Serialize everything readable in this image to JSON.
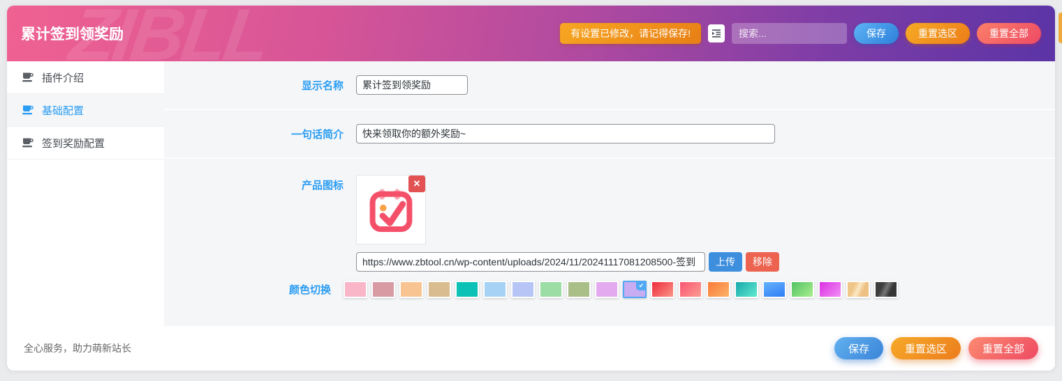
{
  "header": {
    "title": "累计签到领奖励",
    "watermark": "ZIBLL",
    "alert": "有设置已修改，请记得保存!",
    "search_placeholder": "搜索...",
    "save_label": "保存",
    "reset_selection_label": "重置选区",
    "reset_all_label": "重置全部"
  },
  "sidebar": {
    "items": [
      {
        "label": "插件介绍",
        "active": false
      },
      {
        "label": "基础配置",
        "active": true
      },
      {
        "label": "签到奖励配置",
        "active": false
      }
    ]
  },
  "form": {
    "display_name": {
      "label": "显示名称",
      "value": "累计签到领奖励"
    },
    "intro": {
      "label": "一句话简介",
      "value": "快来领取你的额外奖励~"
    },
    "product_icon": {
      "label": "产品图标",
      "delete_label": "✕",
      "url_value": "https://www.zbtool.cn/wp-content/uploads/2024/11/20241117081208500-签到",
      "upload_label": "上传",
      "remove_label": "移除"
    },
    "color_switch": {
      "label": "颜色切换",
      "selected_index": 10,
      "colors": [
        "#f8b6c8",
        "#d89ba4",
        "#f8c592",
        "#d9bd90",
        "#0cc1b5",
        "#a6d3f5",
        "#b7c5f6",
        "#9cdca5",
        "#aabe87",
        "#e3aaf0",
        "#c9adf2",
        "linear-gradient(135deg,#ee2c3c,#fa9486)",
        "linear-gradient(135deg,#fa5573,#fc9d92)",
        "linear-gradient(135deg,#f97b38,#fcb269)",
        "linear-gradient(135deg,#17a8ab,#62e9cf)",
        "linear-gradient(160deg,#66b2fc,#2e7ef5)",
        "linear-gradient(135deg,#52c265,#a9ee8d)",
        "linear-gradient(135deg,#da30e2,#f18ef5)",
        "linear-gradient(115deg,#efc689 30%,#fbe9c3 50%,#edc084 70%)",
        "linear-gradient(115deg,#3d3d3d 30%,#757575 50%,#353535 70%)"
      ]
    }
  },
  "footer": {
    "text": "全心服务，助力萌新站长",
    "save_label": "保存",
    "reset_selection_label": "重置选区",
    "reset_all_label": "重置全部"
  }
}
